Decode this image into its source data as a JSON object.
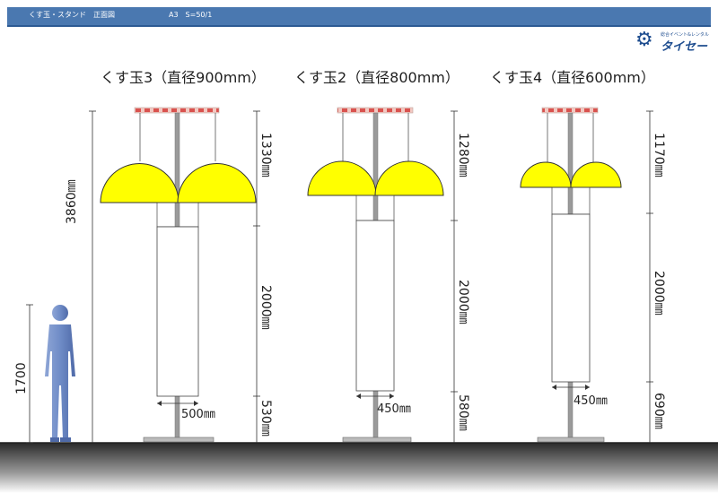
{
  "header": {
    "title": "くす玉・スタンド　正面図",
    "info": "A3　S=50/1"
  },
  "logo": {
    "tagline": "総合イベント&レンタル",
    "name": "タイセー",
    "colors": {
      "primary": "#1e4d8f"
    }
  },
  "colors": {
    "header_bar": "#4a78b0",
    "ball": "#ffff00",
    "pole": "#999999",
    "top_bar_red": "#d9534f",
    "ground": "#333333"
  },
  "person": {
    "height_label": "1700"
  },
  "models": [
    {
      "title": "くす玉3（直径900mm）",
      "total_height": "3860㎜",
      "dim_top": "1330㎜",
      "dim_mid": "2000㎜",
      "dim_bottom": "530㎜",
      "banner_width": "500㎜"
    },
    {
      "title": "くす玉2（直径800mm）",
      "dim_top": "1280㎜",
      "dim_mid": "2000㎜",
      "dim_bottom": "580㎜",
      "banner_width": "450㎜"
    },
    {
      "title": "くす玉4（直径600mm）",
      "dim_top": "1170㎜",
      "dim_mid": "2000㎜",
      "dim_bottom": "690㎜",
      "banner_width": "450㎜"
    }
  ]
}
